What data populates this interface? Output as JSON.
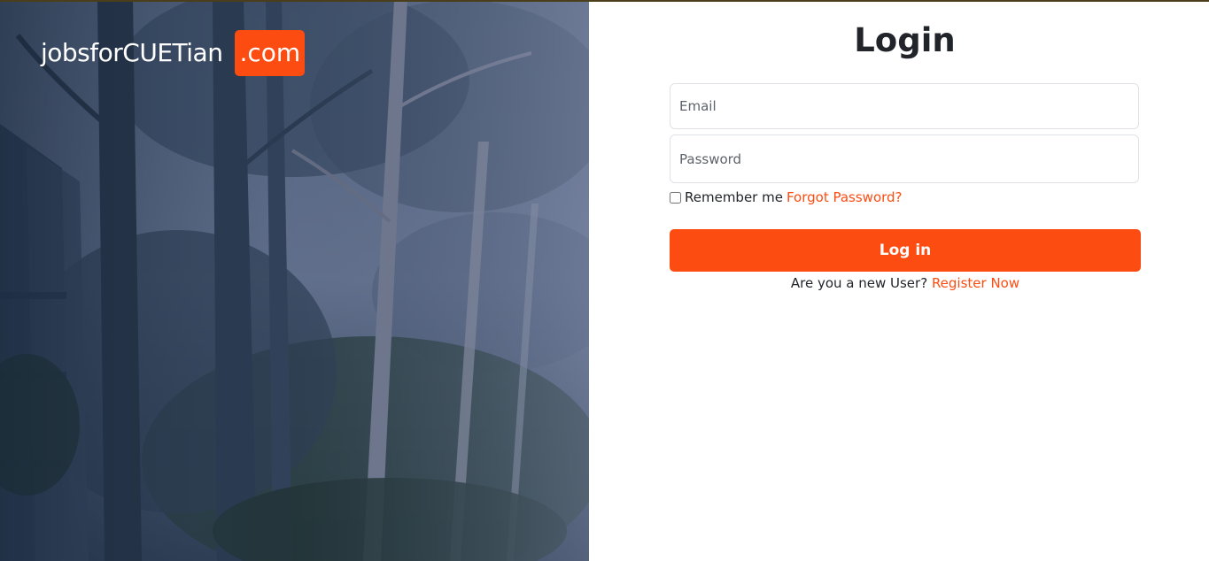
{
  "brand": {
    "name": "jobsforCUETian",
    "badge": ".com",
    "accent_color": "#fc4c12"
  },
  "login": {
    "title": "Login",
    "email_placeholder": "Email",
    "email_value": "",
    "password_placeholder": "Password",
    "password_value": "",
    "remember_label": "Remember me",
    "remember_checked": false,
    "forgot_link": "Forgot Password?",
    "submit_label": "Log in",
    "register_prompt": "Are you a new User?",
    "register_link": "Register Now"
  },
  "hero": {
    "image_subject": "forest-campus-photo"
  }
}
